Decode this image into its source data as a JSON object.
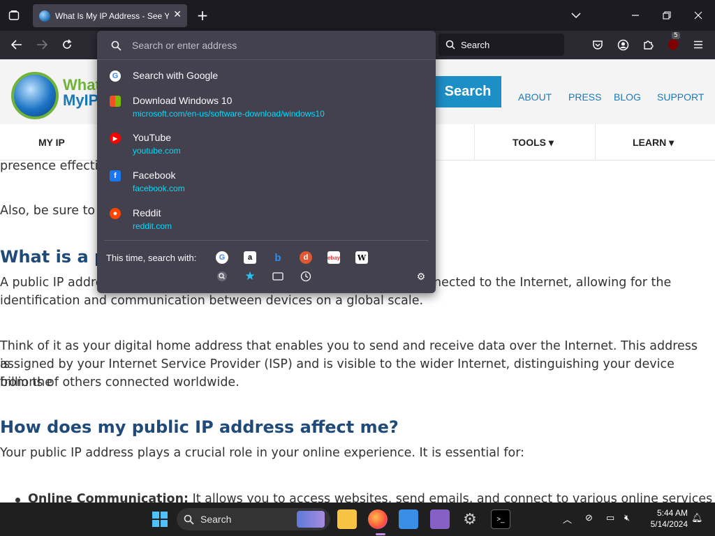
{
  "browser": {
    "tab_title": "What Is My IP Address - See Yo",
    "search_placeholder": "Search",
    "extension_badge": "5"
  },
  "url_dropdown": {
    "placeholder": "Search or enter address",
    "items": [
      {
        "title": "Search with Google",
        "url": "",
        "icon": "google-icon",
        "color": "#ffffff"
      },
      {
        "title": "Download Windows 10",
        "url": "microsoft.com/en-us/software-download/windows10",
        "icon": "windows-icon",
        "color": "#0078d4"
      },
      {
        "title": "YouTube",
        "url": "youtube.com",
        "icon": "youtube-icon",
        "color": "#ff0000"
      },
      {
        "title": "Facebook",
        "url": "facebook.com",
        "icon": "facebook-icon",
        "color": "#1877f2"
      },
      {
        "title": "Reddit",
        "url": "reddit.com",
        "icon": "reddit-icon",
        "color": "#ff4500"
      }
    ],
    "one_time_label": "This time, search with:",
    "engines": [
      "google",
      "amazon",
      "bing",
      "duckduckgo",
      "ebay",
      "wikipedia"
    ],
    "modes": [
      "search-icon",
      "bookmarks-star-icon",
      "tabs-icon",
      "history-clock-icon"
    ]
  },
  "site": {
    "logo_text_1": "What",
    "logo_text_2": "MyIP",
    "search_button": "Search",
    "nav_links": [
      "ABOUT",
      "PRESS",
      "BLOG",
      "SUPPORT"
    ],
    "menu": [
      "MY IP",
      "TOOLS ▾",
      "LEARN ▾"
    ]
  },
  "article": {
    "line1": "presence effectiv",
    "line2": "Also, be sure to r",
    "h1": "What is a pu",
    "p1_start": "A public IP addre",
    "p1_end": "nected to the Internet, allowing for the",
    "p1_line2": "identification and communication between devices on a global scale.",
    "p2_line1": "Think of it as your digital home address that enables you to send and receive data over the Internet. This address is",
    "p2_line2": "assigned by your Internet Service Provider (ISP) and is visible to the wider Internet, distinguishing your device from the",
    "p2_line3": "billions of others connected worldwide.",
    "h2": "How does my public IP address affect me?",
    "p3": "Your public IP address plays a crucial role in your online experience. It is essential for:",
    "bullet_bold": "Online Communication:",
    "bullet_rest": " It allows you to access websites, send emails, and connect to various online services by"
  },
  "taskbar": {
    "search_label": "Search",
    "time": "5:44 AM",
    "date": "5/14/2024"
  }
}
